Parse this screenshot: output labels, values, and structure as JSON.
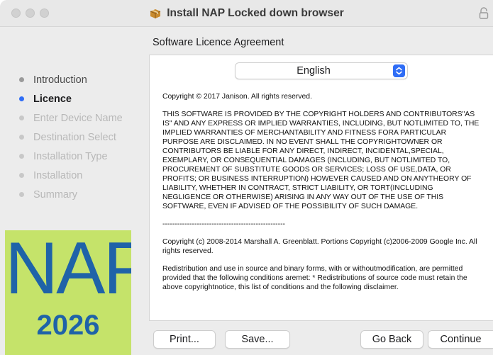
{
  "window": {
    "title": "Install NAP Locked down browser"
  },
  "sidebar": {
    "steps": [
      {
        "label": "Introduction",
        "state": "done"
      },
      {
        "label": "Licence",
        "state": "current"
      },
      {
        "label": "Enter Device Name",
        "state": "pending"
      },
      {
        "label": "Destination Select",
        "state": "pending"
      },
      {
        "label": "Installation Type",
        "state": "pending"
      },
      {
        "label": "Installation",
        "state": "pending"
      },
      {
        "label": "Summary",
        "state": "pending"
      }
    ],
    "logo": {
      "text": "NAP",
      "year": "2026"
    }
  },
  "main": {
    "heading": "Software Licence Agreement",
    "language_select": {
      "value": "English"
    },
    "licence": {
      "copyright1": "Copyright © 2017 Janison. All rights reserved.",
      "disclaimer": "THIS SOFTWARE IS PROVIDED BY THE COPYRIGHT HOLDERS AND CONTRIBUTORS\"AS IS\" AND ANY EXPRESS OR IMPLIED WARRANTIES, INCLUDING, BUT NOTLIMITED TO, THE IMPLIED WARRANTIES OF MERCHANTABILITY AND FITNESS FORA PARTICULAR PURPOSE ARE DISCLAIMED. IN NO EVENT SHALL THE COPYRIGHTOWNER OR CONTRIBUTORS BE LIABLE FOR ANY DIRECT, INDIRECT, INCIDENTAL,SPECIAL, EXEMPLARY, OR CONSEQUENTIAL DAMAGES (INCLUDING, BUT NOTLIMITED TO, PROCUREMENT OF SUBSTITUTE GOODS OR SERVICES; LOSS OF USE,DATA, OR PROFITS; OR BUSINESS INTERRUPTION) HOWEVER CAUSED AND ON ANYTHEORY OF LIABILITY, WHETHER IN CONTRACT, STRICT LIABILITY, OR TORT(INCLUDING NEGLIGENCE OR OTHERWISE) ARISING IN ANY WAY OUT OF THE USE OF THIS SOFTWARE, EVEN IF ADVISED OF THE POSSIBILITY OF SUCH DAMAGE.",
      "separator": "--------------------------------------------------",
      "copyright2": "Copyright (c) 2008-2014 Marshall A. Greenblatt. Portions Copyright (c)2006-2009 Google Inc. All rights reserved.",
      "redistribution": "Redistribution and use in source and binary forms, with or withoutmodification, are permitted provided that the following conditions aremet:   * Redistributions of source code must retain the above copyrightnotice, this list of conditions and the following disclaimer."
    }
  },
  "buttons": {
    "print": "Print...",
    "save": "Save...",
    "go_back": "Go Back",
    "continue": "Continue"
  },
  "colors": {
    "accent": "#2f6df6",
    "logo_bg": "#c5e36a",
    "logo_text": "#1f63a8"
  }
}
